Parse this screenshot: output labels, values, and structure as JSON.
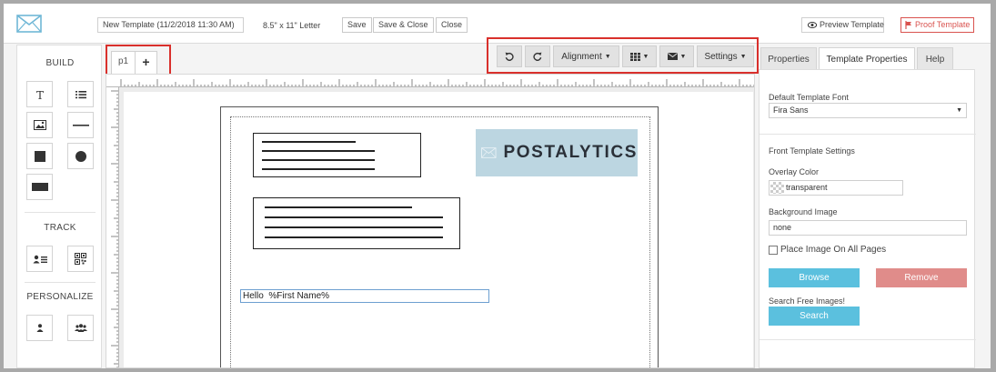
{
  "app": {
    "template_name": "New Template (11/2/2018 11:30 AM)",
    "paper_size": "8.5\" x 11\" Letter",
    "save_label": "Save",
    "save_close_label": "Save & Close",
    "close_label": "Close",
    "preview_label": "Preview Template",
    "proof_label": "Proof Template",
    "colors": {
      "accent_blue": "#5bc0de",
      "danger_red": "#d9534f",
      "highlight": "#d9302c"
    }
  },
  "left_panel": {
    "build_title": "BUILD",
    "track_title": "TRACK",
    "personalize_title": "PERSONALIZE",
    "build_tools": [
      "text-tool",
      "list-tool",
      "image-tool",
      "line-tool",
      "rectangle-tool",
      "circle-tool",
      "bar-tool"
    ],
    "track_tools": [
      "contact-card-tool",
      "qr-code-tool"
    ],
    "personalize_tools": [
      "single-person-tool",
      "group-tool"
    ]
  },
  "page_tabs": {
    "current": "p1",
    "add": "+"
  },
  "toolbar": {
    "alignment_label": "Alignment",
    "settings_label": "Settings",
    "icons": [
      "undo-icon",
      "redo-icon",
      "grid-icon",
      "envelope-icon"
    ]
  },
  "canvas": {
    "brand_text": "POSTALYTICS",
    "hello_text": "Hello  %First Name%"
  },
  "right_panel": {
    "tabs": {
      "properties": "Properties",
      "template_properties": "Template Properties",
      "help": "Help"
    },
    "default_font_label": "Default Template Font",
    "default_font_value": "Fira Sans",
    "front_settings_label": "Front Template Settings",
    "overlay_color_label": "Overlay Color",
    "overlay_color_value": "transparent",
    "background_image_label": "Background Image",
    "background_image_value": "none",
    "place_image_label": "Place Image On All Pages",
    "place_image_checked": false,
    "browse_label": "Browse",
    "remove_label": "Remove",
    "search_free_label": "Search Free Images!",
    "search_label": "Search"
  }
}
